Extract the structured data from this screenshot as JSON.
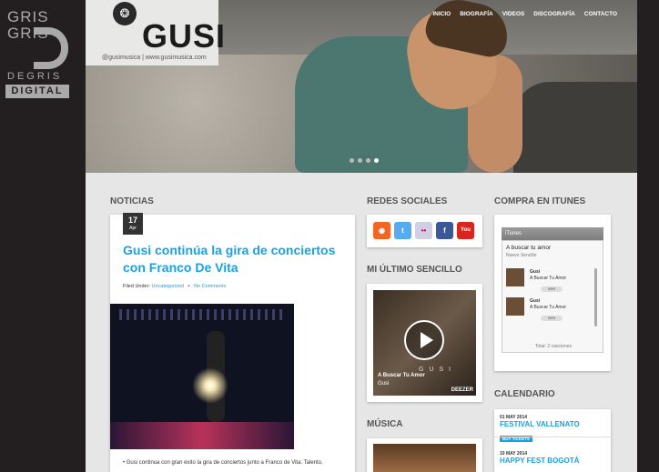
{
  "brand": {
    "line1": "GRIS",
    "line2": "GRIS",
    "sub": "DEGRIS",
    "box": "DIGITAL"
  },
  "header": {
    "logo_text": "GUSI",
    "logo_sub": "@gusimusica | www.gusimusica.com",
    "nav": [
      "INICIO",
      "BIOGRAFÍA",
      "VIDEOS",
      "DISCOGRAFÍA",
      "CONTACTO"
    ],
    "slider_dots": 4,
    "active_dot": 3
  },
  "noticias": {
    "section_title": "NOTICIAS",
    "post": {
      "day": "17",
      "month": "Apr",
      "title": "Gusi continúa la gira de conciertos con Franco De Vita",
      "filed_under_label": "Filed Under:",
      "category": "Uncategorized",
      "comments": "No Comments",
      "excerpt": "• Gusi continua con gran éxito la gira de conciertos junto a Franco de Vita. Talento,"
    }
  },
  "redes": {
    "section_title": "REDES SOCIALES",
    "icons": [
      {
        "name": "rss-icon",
        "glyph": "◉",
        "color": "#f26522"
      },
      {
        "name": "twitter-icon",
        "glyph": "t",
        "color": "#55acee"
      },
      {
        "name": "flickr-icon",
        "glyph": "••",
        "color": "#cfcfe6"
      },
      {
        "name": "facebook-icon",
        "glyph": "f",
        "color": "#3b5998"
      },
      {
        "name": "youtube-icon",
        "glyph": "You",
        "color": "#d9251d"
      }
    ]
  },
  "sencillo": {
    "section_title": "MI ÚLTIMO SENCILLO",
    "artist_overlay": "G U S I",
    "song": "A Buscar Tu Amor",
    "artist": "Gusi",
    "provider": "DEEZER"
  },
  "musica": {
    "section_title": "MÚSICA"
  },
  "itunes": {
    "section_title": "COMPRA EN ITUNES",
    "header": "iTunes",
    "album": "A buscar tu amor",
    "album_sub": "Nuevo Sencillo",
    "tracks": [
      {
        "artist": "Gusi",
        "song": "A Buscar Tu Amor",
        "button": "VER"
      },
      {
        "artist": "Gusi",
        "song": "A Buscar Tu Amor",
        "button": "VER"
      }
    ],
    "total": "Total: 2 canciones"
  },
  "calendario": {
    "section_title": "CALENDARIO",
    "events": [
      {
        "date": "01 MAY 2014",
        "name": "FESTIVAL VALLENATO",
        "button": "BUY TICKETS"
      },
      {
        "date": "10 MAY 2014",
        "name": "HAPPY FEST BOGOTÁ"
      }
    ]
  }
}
